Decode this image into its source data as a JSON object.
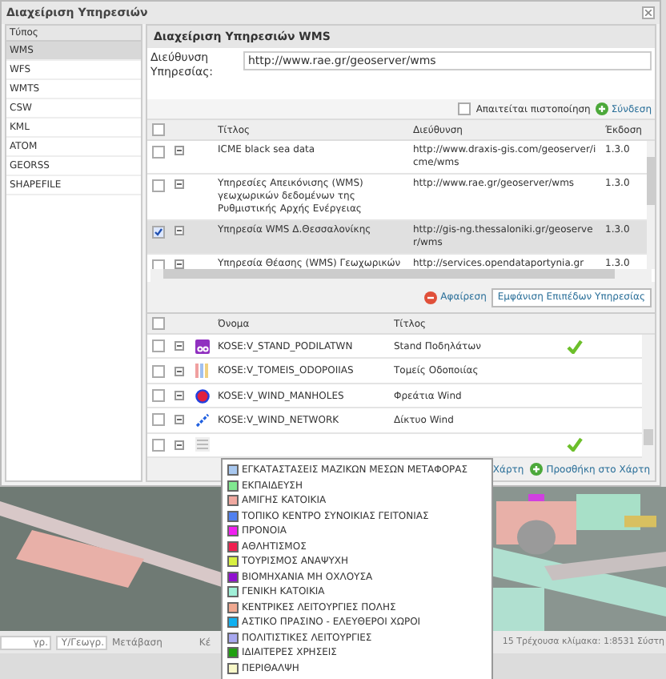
{
  "window": {
    "title": "Διαχείριση Υπηρεσιών"
  },
  "types": {
    "header": "Τύπος",
    "items": [
      {
        "label": "WMS",
        "selected": true
      },
      {
        "label": "WFS",
        "selected": false
      },
      {
        "label": "WMTS",
        "selected": false
      },
      {
        "label": "CSW",
        "selected": false
      },
      {
        "label": "KML",
        "selected": false
      },
      {
        "label": "ATOM",
        "selected": false
      },
      {
        "label": "GEORSS",
        "selected": false
      },
      {
        "label": "SHAPEFILE",
        "selected": false
      }
    ]
  },
  "panel": {
    "title": "Διαχείριση Υπηρεσιών WMS",
    "address_label": "Διεύθυνση Υπηρεσίας:",
    "address_value": "http://www.rae.gr/geoserver/wms",
    "auth_label": "Απαιτείται πιστοποίηση",
    "auth_checked": false,
    "connect": "Σύνδεση"
  },
  "services": {
    "all_checked": false,
    "columns": [
      "Τίτλος",
      "Διεύθυνση",
      "Έκδοση"
    ],
    "rows": [
      {
        "title": "ICME black sea data",
        "url": "http://www.draxis-gis.com/geoserver/icme/wms",
        "version": "1.3.0",
        "checked": false
      },
      {
        "title": "Υπηρεσίες Απεικόνισης (WMS) γεωχωρικών δεδομένων της Ρυθμιστικής Αρχής Ενέργειας",
        "url": "http://www.rae.gr/geoserver/wms",
        "version": "1.3.0",
        "checked": false
      },
      {
        "title": "Υπηρεσία WMS Δ.Θεσσαλονίκης",
        "url": "http://gis-ng.thessaloniki.gr/geoserver/wms",
        "version": "1.3.0",
        "checked": true
      },
      {
        "title": "Υπηρεσία Θέασης (WMS) Γεωχωρικών",
        "url": "http://services.opendataportynia.gr",
        "version": "1.3.0",
        "checked": false
      }
    ],
    "remove": "Αφαίρεση",
    "show_layers": "Εμφάνιση Επιπέδων Υπηρεσίας"
  },
  "layers": {
    "all_checked": false,
    "columns": [
      "Όνομα",
      "Τίτλος"
    ],
    "rows": [
      {
        "name": "KOSE:V_STAND_PODILATWN",
        "title": "Stand Ποδηλάτων",
        "kind": "bike",
        "added": true,
        "checked": false
      },
      {
        "name": "KOSE:V_TOMEIS_ODOPOIIAS",
        "title": "Τομείς Οδοποιίας",
        "kind": "bars",
        "added": false,
        "checked": false
      },
      {
        "name": "KOSE:V_WIND_MANHOLES",
        "title": "Φρεάτια Wind",
        "kind": "dot",
        "added": false,
        "checked": false
      },
      {
        "name": "KOSE:V_WIND_NETWORK",
        "title": "Δίκτυο Wind",
        "kind": "line",
        "added": false,
        "checked": false
      },
      {
        "name": "",
        "title": "",
        "kind": "legend",
        "added": true,
        "checked": false
      }
    ],
    "remove_from_map": "Χάρτη",
    "add_to_map": "Προσθήκη στο Χάρτη"
  },
  "status_bar": {
    "fields": [
      "γρ.",
      "Υ/Γεωγρ."
    ],
    "go": "Μετάβαση",
    "center": "Κέ",
    "scale": "15 Τρέχουσα κλίμακα: 1:8531 Σύστη"
  },
  "legend": [
    {
      "label": "ΕΓΚΑΤΑΣΤΑΣΕΙΣ ΜΑΖΙΚΩΝ ΜΕΣΩΝ ΜΕΤΑΦΟΡΑΣ",
      "color": "#a8c8f0"
    },
    {
      "label": "ΕΚΠΑΙΔΕΥΣΗ",
      "color": "#80e890"
    },
    {
      "label": "ΑΜΙΓΗΣ ΚΑΤΟΙΚΙΑ",
      "color": "#f0a8a0"
    },
    {
      "label": "ΤΟΠΙΚΟ ΚΕΝΤΡΟ ΣΥΝΟΙΚΙΑΣ ΓΕΙΤΟΝΙΑΣ",
      "color": "#5080f0"
    },
    {
      "label": "ΠΡΟΝΟΙΑ",
      "color": "#f020f0"
    },
    {
      "label": "ΑΘΛΗΤΙΣΜΟΣ",
      "color": "#f02050"
    },
    {
      "label": "ΤΟΥΡΙΣΜΟΣ ΑΝΑΨΥΧΗ",
      "color": "#d8f040"
    },
    {
      "label": "ΒΙΟΜΗΧΑΝΙΑ ΜΗ ΟΧΛΟΥΣΑ",
      "color": "#9010d0"
    },
    {
      "label": "ΓΕΝΙΚΗ ΚΑΤΟΙΚΙΑ",
      "color": "#a0f0d8"
    },
    {
      "label": "ΚΕΝΤΡΙΚΕΣ ΛΕΙΤΟΥΡΓΙΕΣ ΠΟΛΗΣ",
      "color": "#f0a890"
    },
    {
      "label": "ΑΣΤΙΚΟ ΠΡΑΣΙΝΟ - ΕΛΕΥΘΕΡΟΙ ΧΩΡΟΙ",
      "color": "#10b0f0"
    },
    {
      "label": "ΠΟΛΙΤΙΣΤΙΚΕΣ ΛΕΙΤΟΥΡΓΙΕΣ",
      "color": "#a8a8f0"
    },
    {
      "label": "ΙΔΙΑΙΤΕΡΕΣ ΧΡΗΣΕΙΣ",
      "color": "#20a010"
    },
    {
      "label": "ΠΕΡΙΘΑΛΨΗ",
      "color": "#f8f8c8"
    }
  ]
}
